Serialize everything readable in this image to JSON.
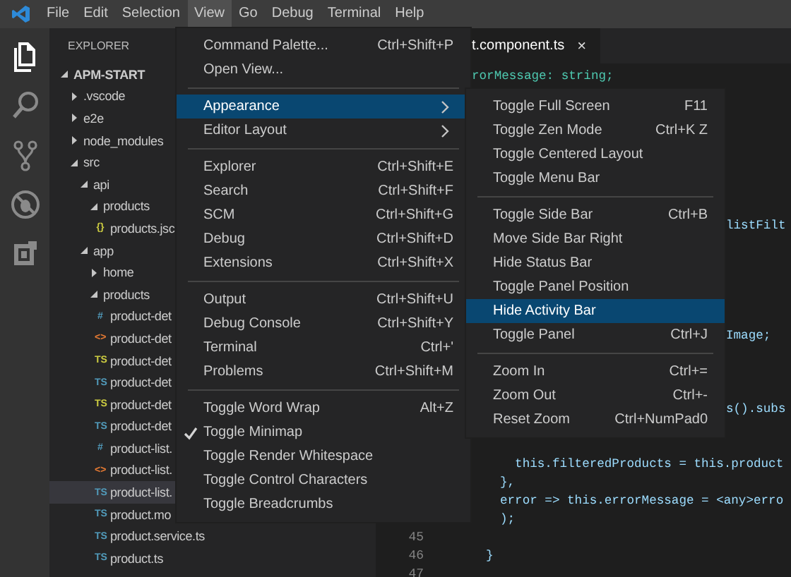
{
  "menubar": {
    "items": [
      {
        "label": "File",
        "selected": false
      },
      {
        "label": "Edit",
        "selected": false
      },
      {
        "label": "Selection",
        "selected": false
      },
      {
        "label": "View",
        "selected": true
      },
      {
        "label": "Go",
        "selected": false
      },
      {
        "label": "Debug",
        "selected": false
      },
      {
        "label": "Terminal",
        "selected": false
      },
      {
        "label": "Help",
        "selected": false
      }
    ]
  },
  "activity_bar": {
    "items": [
      {
        "kind": "files",
        "selected": true
      },
      {
        "kind": "search",
        "selected": false
      },
      {
        "kind": "scm",
        "selected": false
      },
      {
        "kind": "debug",
        "selected": false
      },
      {
        "kind": "extensions",
        "selected": false
      }
    ]
  },
  "sidebar": {
    "title": "EXPLORER",
    "tree": [
      {
        "label": "APM-START",
        "kind": "root",
        "expanded": true,
        "selected": false,
        "children": [
          {
            "label": ".vscode",
            "kind": "folder",
            "expanded": false,
            "selected": false
          },
          {
            "label": "e2e",
            "kind": "folder",
            "expanded": false,
            "selected": false
          },
          {
            "label": "node_modules",
            "kind": "folder",
            "expanded": false,
            "selected": false
          },
          {
            "label": "src",
            "kind": "folder",
            "expanded": true,
            "selected": false,
            "children": [
              {
                "label": "api",
                "kind": "folder",
                "expanded": true,
                "selected": false,
                "children": [
                  {
                    "label": "products",
                    "kind": "folder",
                    "expanded": true,
                    "selected": false,
                    "children": [
                      {
                        "label": "products.jsc",
                        "kind": "json",
                        "icon": "{}",
                        "selected": false
                      }
                    ]
                  }
                ]
              },
              {
                "label": "app",
                "kind": "folder",
                "expanded": true,
                "selected": false,
                "children": [
                  {
                    "label": "home",
                    "kind": "folder",
                    "expanded": false,
                    "selected": false
                  },
                  {
                    "label": "products",
                    "kind": "folder",
                    "expanded": true,
                    "selected": false,
                    "children": [
                      {
                        "label": "product-det",
                        "kind": "css",
                        "icon": "#",
                        "selected": false
                      },
                      {
                        "label": "product-det",
                        "kind": "html",
                        "icon": "<>",
                        "selected": false
                      },
                      {
                        "label": "product-det",
                        "kind": "spec",
                        "icon": "TS",
                        "selected": false
                      },
                      {
                        "label": "product-det",
                        "kind": "ts",
                        "icon": "TS",
                        "selected": false
                      },
                      {
                        "label": "product-det",
                        "kind": "spec",
                        "icon": "TS",
                        "selected": false
                      },
                      {
                        "label": "product-det",
                        "kind": "ts",
                        "icon": "TS",
                        "selected": false
                      },
                      {
                        "label": "product-list.",
                        "kind": "css",
                        "icon": "#",
                        "selected": false
                      },
                      {
                        "label": "product-list.",
                        "kind": "html",
                        "icon": "<>",
                        "selected": false
                      },
                      {
                        "label": "product-list.",
                        "kind": "ts",
                        "icon": "TS",
                        "selected": true
                      },
                      {
                        "label": "product.mo",
                        "kind": "ts",
                        "icon": "TS",
                        "selected": false
                      },
                      {
                        "label": "product.service.ts",
                        "kind": "ts",
                        "icon": "TS",
                        "selected": false
                      },
                      {
                        "label": "product.ts",
                        "kind": "ts",
                        "icon": "TS",
                        "selected": false
                      }
                    ]
                  }
                ]
              }
            ]
          }
        ]
      }
    ]
  },
  "editor": {
    "tab": {
      "label": "t.component.ts",
      "close": "×"
    },
    "code_lines": [
      "rorMessage: string;",
      "listFilt",
      "Image;",
      "s().subs",
      "  this.filteredProducts = this.product",
      "},",
      "error => this.errorMessage = <any>erro",
      ");",
      "}"
    ],
    "line_numbers": [
      "45",
      "46",
      "47"
    ]
  },
  "view_menu": {
    "groups": [
      [
        {
          "label": "Command Palette...",
          "shortcut": "Ctrl+Shift+P",
          "selected": false,
          "checked": false
        },
        {
          "label": "Open View...",
          "selected": false,
          "checked": false
        }
      ],
      [
        {
          "label": "Appearance",
          "kind": "submenu",
          "selected": true,
          "checked": false
        },
        {
          "label": "Editor Layout",
          "kind": "submenu",
          "selected": false,
          "checked": false
        }
      ],
      [
        {
          "label": "Explorer",
          "shortcut": "Ctrl+Shift+E",
          "selected": false,
          "checked": false
        },
        {
          "label": "Search",
          "shortcut": "Ctrl+Shift+F",
          "selected": false,
          "checked": false
        },
        {
          "label": "SCM",
          "shortcut": "Ctrl+Shift+G",
          "selected": false,
          "checked": false
        },
        {
          "label": "Debug",
          "shortcut": "Ctrl+Shift+D",
          "selected": false,
          "checked": false
        },
        {
          "label": "Extensions",
          "shortcut": "Ctrl+Shift+X",
          "selected": false,
          "checked": false
        }
      ],
      [
        {
          "label": "Output",
          "shortcut": "Ctrl+Shift+U",
          "selected": false,
          "checked": false
        },
        {
          "label": "Debug Console",
          "shortcut": "Ctrl+Shift+Y",
          "selected": false,
          "checked": false
        },
        {
          "label": "Terminal",
          "shortcut": "Ctrl+'",
          "selected": false,
          "checked": false
        },
        {
          "label": "Problems",
          "shortcut": "Ctrl+Shift+M",
          "selected": false,
          "checked": false
        }
      ],
      [
        {
          "label": "Toggle Word Wrap",
          "shortcut": "Alt+Z",
          "selected": false,
          "checked": false
        },
        {
          "label": "Toggle Minimap",
          "selected": false,
          "checked": true
        },
        {
          "label": "Toggle Render Whitespace",
          "selected": false,
          "checked": false
        },
        {
          "label": "Toggle Control Characters",
          "selected": false,
          "checked": false
        },
        {
          "label": "Toggle Breadcrumbs",
          "selected": false,
          "checked": false
        }
      ]
    ]
  },
  "appearance_submenu": {
    "groups": [
      [
        {
          "label": "Toggle Full Screen",
          "shortcut": "F11",
          "selected": false
        },
        {
          "label": "Toggle Zen Mode",
          "shortcut": "Ctrl+K Z",
          "selected": false
        },
        {
          "label": "Toggle Centered Layout",
          "selected": false
        },
        {
          "label": "Toggle Menu Bar",
          "selected": false
        }
      ],
      [
        {
          "label": "Toggle Side Bar",
          "shortcut": "Ctrl+B",
          "selected": false
        },
        {
          "label": "Move Side Bar Right",
          "selected": false
        },
        {
          "label": "Hide Status Bar",
          "selected": false
        },
        {
          "label": "Toggle Panel Position",
          "selected": false
        },
        {
          "label": "Hide Activity Bar",
          "selected": true
        },
        {
          "label": "Toggle Panel",
          "shortcut": "Ctrl+J",
          "selected": false
        }
      ],
      [
        {
          "label": "Zoom In",
          "shortcut": "Ctrl+=",
          "selected": false
        },
        {
          "label": "Zoom Out",
          "shortcut": "Ctrl+-",
          "selected": false
        },
        {
          "label": "Reset Zoom",
          "shortcut": "Ctrl+NumPad0",
          "selected": false
        }
      ]
    ]
  }
}
